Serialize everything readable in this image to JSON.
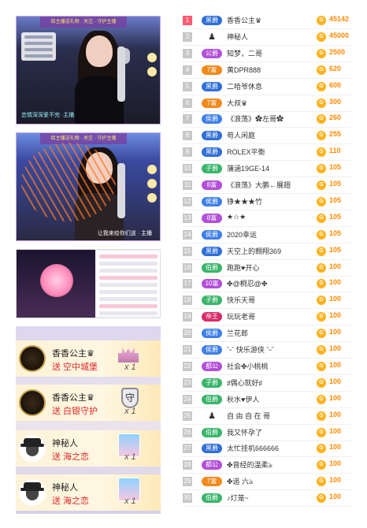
{
  "colors": {
    "badge_black": "#2f6fd6",
    "badge_purple": "#b34fd8",
    "badge_orange": "#f08a1e",
    "badge_blue": "#3f7fe8",
    "badge_green": "#39b56a",
    "badge_navy": "#3a55b8",
    "badge_red": "#d92b6a",
    "badge_gray": "#9a9a9a",
    "score": "#ff8a00",
    "send_red": "#e0262a"
  },
  "stream1": {
    "top_text": "给主播送礼物 · 关注 · 守护主播",
    "bottom_text": "恋情深深爱不完 ·主播"
  },
  "stream2": {
    "top_text": "给主播送礼物 · 关注 · 守护主播",
    "bottom_text": "让我来给你们送 · 主播"
  },
  "gifts": [
    {
      "name": "香香公主♛",
      "send": "送 空中城堡",
      "count": "x 1",
      "avatar": "crown-avatar",
      "icon": "castle-icon"
    },
    {
      "name": "香香公主♛",
      "send": "送 白银守护",
      "count": "x 1",
      "avatar": "crown-avatar",
      "icon": "shield-icon",
      "icon_text": "守"
    },
    {
      "name": "神秘人",
      "send": "送 海之恋",
      "count": "x 1",
      "avatar": "anonymous-avatar",
      "icon": "card-icon"
    },
    {
      "name": "神秘人",
      "send": "送 海之恋",
      "count": "x 1",
      "avatar": "anonymous-avatar",
      "icon": "card-icon"
    }
  ],
  "ranking": [
    {
      "rank": "1",
      "badge": "黑爵",
      "badge_color": "#2f6fd6",
      "name": "香香公主♛",
      "score": "45142"
    },
    {
      "rank": "2",
      "badge": "",
      "badge_color": "",
      "name": "神秘人",
      "score": "45000"
    },
    {
      "rank": "3",
      "badge": "公爵",
      "badge_color": "#b34fd8",
      "name": "知梦，二哥",
      "score": "2500"
    },
    {
      "rank": "4",
      "badge": "7富",
      "badge_color": "#f08a1e",
      "name": "黄DPR888",
      "score": "620"
    },
    {
      "rank": "5",
      "badge": "黑爵",
      "badge_color": "#2f6fd6",
      "name": "二哈爷休息",
      "score": "600"
    },
    {
      "rank": "6",
      "badge": "7富",
      "badge_color": "#f08a1e",
      "name": "大叔♛",
      "score": "300"
    },
    {
      "rank": "7",
      "badge": "侯爵",
      "badge_color": "#3f7fe8",
      "name": "《浪荡》✿左哥✿",
      "score": "260"
    },
    {
      "rank": "8",
      "badge": "黑爵",
      "badge_color": "#2f6fd6",
      "name": "苟人闲庭",
      "score": "255"
    },
    {
      "rank": "9",
      "badge": "黑爵",
      "badge_color": "#2f6fd6",
      "name": "ROLEX平衡",
      "score": "110"
    },
    {
      "rank": "10",
      "badge": "子爵",
      "badge_color": "#39b56a",
      "name": "蒲涵19GE-14",
      "score": "105"
    },
    {
      "rank": "11",
      "badge": "8富",
      "badge_color": "#b34fd8",
      "name": "《浪荡》大鹏←展翅",
      "score": "105"
    },
    {
      "rank": "12",
      "badge": "侯爵",
      "badge_color": "#3f7fe8",
      "name": "铮★★★竹",
      "score": "105"
    },
    {
      "rank": "13",
      "badge": "8富",
      "badge_color": "#b34fd8",
      "name": "★☆★",
      "score": "105"
    },
    {
      "rank": "14",
      "badge": "侯爵",
      "badge_color": "#3f7fe8",
      "name": "2020幸运",
      "score": "105"
    },
    {
      "rank": "15",
      "badge": "黑爵",
      "badge_color": "#2f6fd6",
      "name": "天空上的翱翔369",
      "score": "105"
    },
    {
      "rank": "16",
      "badge": "伯爵",
      "badge_color": "#39b56a",
      "name": "跑跑♥开心",
      "score": "100"
    },
    {
      "rank": "17",
      "badge": "10富",
      "badge_color": "#b34fd8",
      "name": "✤@桐忍@✤",
      "score": "100"
    },
    {
      "rank": "18",
      "badge": "子爵",
      "badge_color": "#39b56a",
      "name": "快乐天哥",
      "score": "100"
    },
    {
      "rank": "19",
      "badge": "帝王",
      "badge_color": "#d92b6a",
      "name": "玩玩老哥",
      "score": "100"
    },
    {
      "rank": "20",
      "badge": "侯爵",
      "badge_color": "#3f7fe8",
      "name": "兰花郎",
      "score": "100"
    },
    {
      "rank": "21",
      "badge": "侯爵",
      "badge_color": "#3f7fe8",
      "name": "ˇᵕˇ 快乐游侠 ˇᵕˇ",
      "score": "100"
    },
    {
      "rank": "22",
      "badge": "都公",
      "badge_color": "#b34fd8",
      "name": "社会✤小桃桃",
      "score": "100"
    },
    {
      "rank": "23",
      "badge": "子爵",
      "badge_color": "#39b56a",
      "name": "♯偶心就好♯",
      "score": "100"
    },
    {
      "rank": "24",
      "badge": "伯爵",
      "badge_color": "#39b56a",
      "name": "秋水♥伊人",
      "score": "100"
    },
    {
      "rank": "25",
      "badge": "",
      "badge_color": "",
      "name": "自 由 自 在 哥",
      "score": "100"
    },
    {
      "rank": "26",
      "badge": "伯爵",
      "badge_color": "#39b56a",
      "name": "我又怀孕了",
      "score": "100"
    },
    {
      "rank": "27",
      "badge": "黑爵",
      "badge_color": "#2f6fd6",
      "name": "太忙挂机666666",
      "score": "100"
    },
    {
      "rank": "28",
      "badge": "都公",
      "badge_color": "#b34fd8",
      "name": "✤曾经的温柔ঌ",
      "score": "100"
    },
    {
      "rank": "29",
      "badge": "7富",
      "badge_color": "#f08a1e",
      "name": "✤追 六ঌ",
      "score": "100"
    },
    {
      "rank": "30",
      "badge": "伯爵",
      "badge_color": "#39b56a",
      "name": "♪灯笼~",
      "score": "100"
    }
  ]
}
